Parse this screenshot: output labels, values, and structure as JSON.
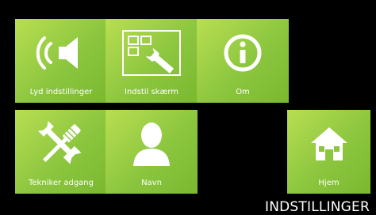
{
  "colors": {
    "background": "#000000",
    "tile": "#8cc63f",
    "tile_highlight": "#b9de52",
    "text": "#ffffff"
  },
  "tiles": [
    {
      "label": "Lyd indstillinger",
      "icon": "speaker-icon"
    },
    {
      "label": "Indstil skærm",
      "icon": "screen-settings-icon"
    },
    {
      "label": "Om",
      "icon": "info-icon"
    },
    {
      "label": "Tekniker adgang",
      "icon": "tools-icon"
    },
    {
      "label": "Navn",
      "icon": "person-icon"
    },
    {
      "label": "Hjem",
      "icon": "home-icon"
    }
  ],
  "page_title": "INDSTILLINGER"
}
